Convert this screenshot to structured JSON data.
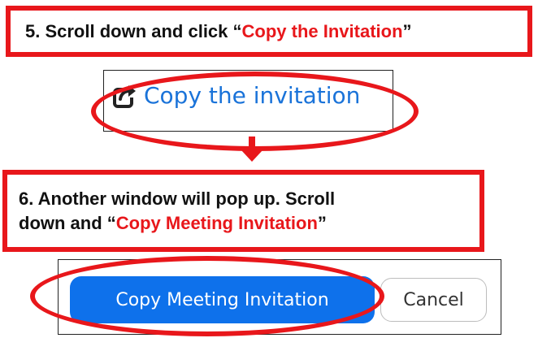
{
  "step5": {
    "prefix": "5. Scroll down and click “",
    "highlight": "Copy the Invitation",
    "suffix": "”"
  },
  "copy_link": {
    "icon": "share-icon",
    "label": "Copy the invitation"
  },
  "step6": {
    "line1": "6. Another window will pop up. Scroll",
    "line2_prefix": "down and  “",
    "highlight": "Copy Meeting Invitation",
    "suffix": "”"
  },
  "buttons": {
    "primary_label": "Copy Meeting Invitation",
    "cancel_label": "Cancel"
  },
  "colors": {
    "annotation_red": "#e8171b",
    "link_blue": "#1a73d9",
    "primary_blue": "#0e71eb"
  }
}
